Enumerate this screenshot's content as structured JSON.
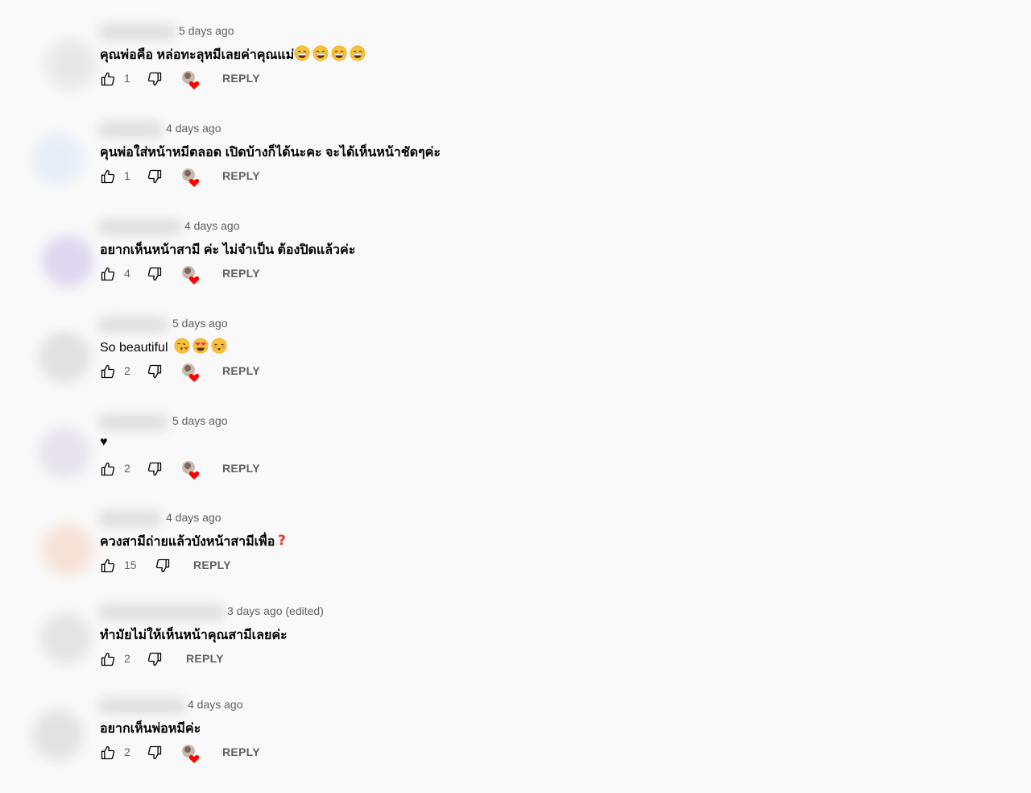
{
  "comments": [
    {
      "time": "5 days ago",
      "text": "คุณพ่อคือ หล่อทะลุหมีเลยค่าคุณแม่",
      "emojis": [
        "grin",
        "grin",
        "grin",
        "grin"
      ],
      "likes": "1",
      "hearted": true,
      "reply": "REPLY",
      "avatar_color": "#e6e6e6"
    },
    {
      "time": "4 days ago",
      "text": "คุนพ่อใส่หน้าหมีตลอด เปิดบ้างก็ได้นะคะ จะได้เห็นหน้าชัดๆค่ะ",
      "emojis": [],
      "likes": "1",
      "hearted": true,
      "reply": "REPLY",
      "avatar_color": "#e4ecf5"
    },
    {
      "time": "4 days ago",
      "text": "อยากเห็นหน้าสามี ค่ะ ไม่จำเป็น ต้องปิดแล้วค่ะ",
      "emojis": [],
      "likes": "4",
      "hearted": true,
      "reply": "REPLY",
      "avatar_color": "#d9d2ef"
    },
    {
      "time": "5 days ago",
      "text": "So beautiful",
      "emojis": [
        "kiss-heart",
        "heart-eyes",
        "kiss-blush"
      ],
      "likes": "2",
      "hearted": true,
      "reply": "REPLY",
      "avatar_color": "#dedede"
    },
    {
      "time": "5 days ago",
      "text": "♥",
      "emojis": [],
      "likes": "2",
      "hearted": true,
      "reply": "REPLY",
      "avatar_color": "#e4e1ea"
    },
    {
      "time": "4 days ago",
      "text": "ควงสามีถ่ายแล้วบังหน้าสามีเพื่อ",
      "emojis": [
        "red-question"
      ],
      "likes": "15",
      "hearted": false,
      "reply": "REPLY",
      "avatar_color": "#f6dfd2"
    },
    {
      "time": "3 days ago (edited)",
      "text": "ทำมัยไม่ให้เห็นหน้าคุณสามีเลยค่ะ",
      "emojis": [],
      "likes": "2",
      "hearted": false,
      "reply": "REPLY",
      "avatar_color": "#e2e2e2"
    },
    {
      "time": "4 days ago",
      "text": "อยากเห็นพ่อหมีค่ะ",
      "emojis": [],
      "likes": "2",
      "hearted": true,
      "reply": "REPLY",
      "avatar_color": "#e0e0e0"
    }
  ],
  "icons": {
    "like": "thumb-up-icon",
    "dislike": "thumb-down-icon",
    "heart": "creator-heart-icon"
  },
  "colors": {
    "background": "#f9f9f9",
    "meta": "#606060",
    "heart": "#ff0000"
  }
}
